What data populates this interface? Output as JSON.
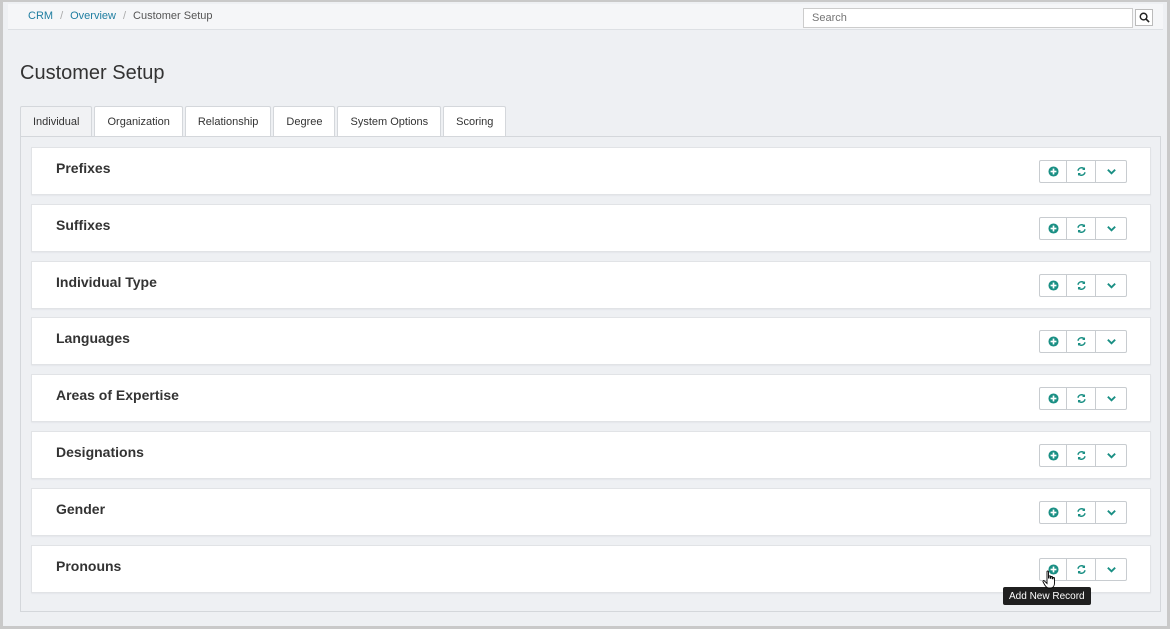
{
  "breadcrumb": {
    "items": [
      "CRM",
      "Overview"
    ],
    "separator": "/",
    "current": "Customer Setup"
  },
  "search": {
    "placeholder": "Search",
    "icon": "search-icon"
  },
  "page": {
    "title": "Customer Setup"
  },
  "tabs": [
    {
      "label": "Individual",
      "active": true
    },
    {
      "label": "Organization"
    },
    {
      "label": "Relationship"
    },
    {
      "label": "Degree"
    },
    {
      "label": "System Options"
    },
    {
      "label": "Scoring"
    }
  ],
  "sections": [
    {
      "title": "Prefixes"
    },
    {
      "title": "Suffixes"
    },
    {
      "title": "Individual Type"
    },
    {
      "title": "Languages"
    },
    {
      "title": "Areas of Expertise"
    },
    {
      "title": "Designations"
    },
    {
      "title": "Gender"
    },
    {
      "title": "Pronouns"
    }
  ],
  "section_buttons": {
    "add_icon": "plus-circle-icon",
    "refresh_icon": "refresh-icon",
    "expand_icon": "chevron-down-icon"
  },
  "tooltip": {
    "text": "Add New Record"
  },
  "colors": {
    "accent": "#1a8f84",
    "link": "#1f7ea1"
  }
}
